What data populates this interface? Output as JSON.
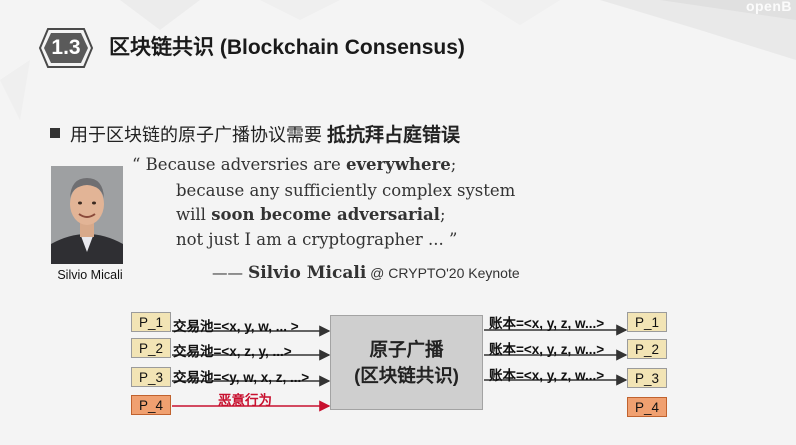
{
  "watermark": "openB",
  "slide": {
    "section_number": "1.3",
    "title": "区块链共识 (Blockchain Consensus)",
    "bullet_prefix": "用于区块链的原子广播协议需要",
    "bullet_emphasis": "抵抗拜占庭错误",
    "quote": {
      "open": "“ Because adversries are ",
      "open_bold": "everywhere",
      "open_end": ";",
      "line2": "because any sufficiently complex system",
      "line3_pre": "will ",
      "line3_bold": "soon become adversarial",
      "line3_end": ";",
      "line4": "not just I am a cryptographer ... ”"
    },
    "attribution": {
      "dash": "—— ",
      "name": "Silvio Micali",
      "venue": " @ CRYPTO'20 Keynote"
    },
    "photo_caption": "Silvio Micali"
  },
  "diagram": {
    "left_nodes": [
      "P_1",
      "P_2",
      "P_3",
      "P_4"
    ],
    "right_nodes": [
      "P_1",
      "P_2",
      "P_3",
      "P_4"
    ],
    "input_labels": [
      "交易池=<x, y, w, ... >",
      "交易池=<x, z, y, ...>",
      "交易池=<y, w, x, z, ...>"
    ],
    "malicious_label": "恶意行为",
    "center_line1": "原子广播",
    "center_line2": "(区块链共识)",
    "output_labels": [
      "账本=<x, y, z, w...>",
      "账本=<x, y, z, w...>",
      "账本=<x, y, z, w...>"
    ],
    "colors": {
      "honest_node": "#f2e4b5",
      "malicious_node": "#f0a070",
      "malicious_arrow": "#c8102e",
      "center_box": "#cfcfcf"
    }
  }
}
